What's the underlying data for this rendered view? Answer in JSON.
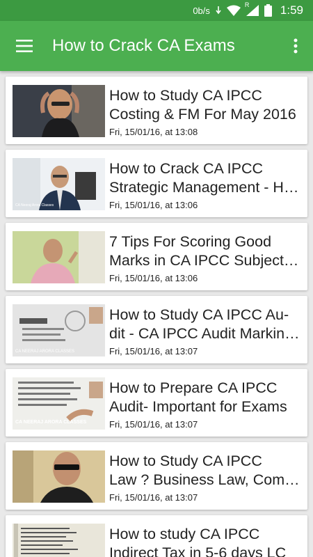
{
  "status_bar": {
    "net_speed": "0b/s",
    "roaming": "R",
    "time": "1:59"
  },
  "app_bar": {
    "title": "How to Crack CA Exams",
    "menu_icon": "hamburger-menu-icon",
    "overflow_icon": "more-vert-icon",
    "color": "#4caf50"
  },
  "videos": [
    {
      "title_line1": "How to Study CA IPCC",
      "title_line2": "Costing & FM For May 2016",
      "date": "Fri, 15/01/16, at 13:08"
    },
    {
      "title_line1": "How to Crack CA IPCC",
      "title_line2": "Strategic Management - How to",
      "date": "Fri, 15/01/16, at 13:06"
    },
    {
      "title_line1": "7 Tips For Scoring Good",
      "title_line2": "Marks in CA IPCC Subject Law",
      "date": "Fri, 15/01/16, at 13:06"
    },
    {
      "title_line1": "How to Study CA IPCC Au-",
      "title_line2": "dit - CA IPCC Audit Marking Scheme",
      "date": "Fri, 15/01/16, at 13:07"
    },
    {
      "title_line1": "How to Prepare CA IPCC",
      "title_line2": "Audit- Important for Exams",
      "date": "Fri, 15/01/16, at 13:07"
    },
    {
      "title_line1": "How to Study CA IPCC",
      "title_line2": "Law ? Business Law, Company Law",
      "date": "Fri, 15/01/16, at 13:07"
    },
    {
      "title_line1": "How to study CA IPCC",
      "title_line2": "Indirect Tax in 5-6 days LC",
      "date": ""
    }
  ],
  "thumb_captions": {
    "t2": "CA Neeraj Arora Classes",
    "t4": "CA NEERAJ ARORA CLASSES",
    "t5": "CA NEERAJ ARORA CLASSES"
  }
}
